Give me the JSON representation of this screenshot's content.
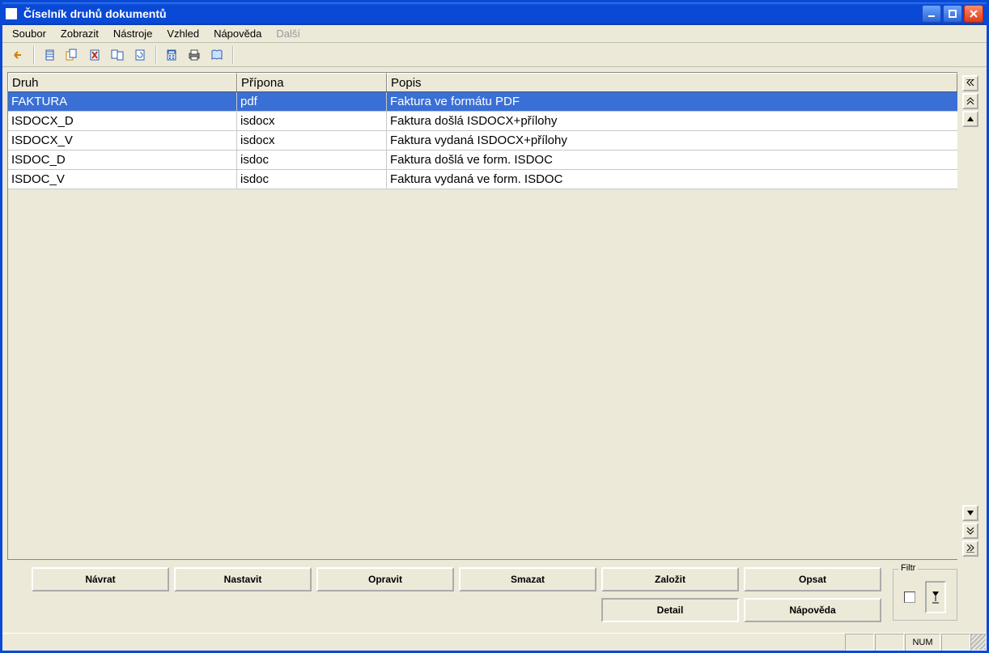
{
  "window": {
    "title": "Číselník druhů dokumentů"
  },
  "menu": {
    "file": "Soubor",
    "view": "Zobrazit",
    "tools": "Nástroje",
    "appearance": "Vzhled",
    "help": "Nápověda",
    "more": "Další"
  },
  "toolbar_icons": [
    "back-arrow-icon",
    "new-doc-icon",
    "copy-docs-icon",
    "delete-doc-icon",
    "docs-pair-icon",
    "refresh-doc-icon",
    "calculator-icon",
    "printer-icon",
    "book-icon"
  ],
  "table": {
    "columns": {
      "type": "Druh",
      "ext": "Přípona",
      "desc": "Popis"
    },
    "rows": [
      {
        "type": "FAKTURA",
        "ext": "pdf",
        "desc": "Faktura ve formátu PDF",
        "selected": true
      },
      {
        "type": "ISDOCX_D",
        "ext": "isdocx",
        "desc": "Faktura došlá ISDOCX+přílohy",
        "selected": false
      },
      {
        "type": "ISDOCX_V",
        "ext": "isdocx",
        "desc": "Faktura vydaná ISDOCX+přílohy",
        "selected": false
      },
      {
        "type": "ISDOC_D",
        "ext": "isdoc",
        "desc": "Faktura došlá ve form. ISDOC",
        "selected": false
      },
      {
        "type": "ISDOC_V",
        "ext": "isdoc",
        "desc": "Faktura vydaná ve form. ISDOC",
        "selected": false
      }
    ]
  },
  "buttons": {
    "navrat": "Návrat",
    "nastavit": "Nastavit",
    "opravit": "Opravit",
    "smazat": "Smazat",
    "zalozit": "Založit",
    "opsat": "Opsat",
    "detail": "Detail",
    "napoveda": "Nápověda"
  },
  "filter": {
    "label": "Filtr"
  },
  "status": {
    "num": "NUM"
  }
}
